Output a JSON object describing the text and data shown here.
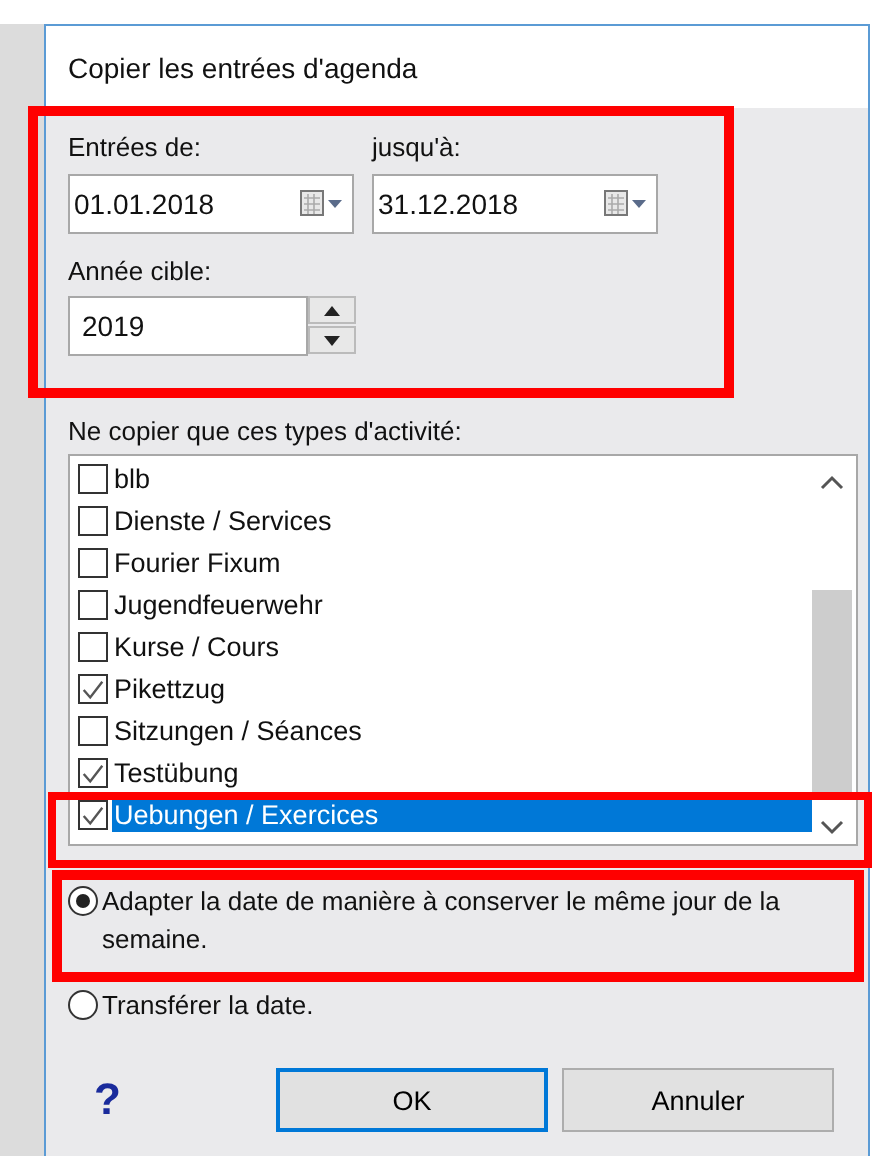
{
  "window": {
    "title": "Copier les entrées d'agenda"
  },
  "date_from": {
    "label": "Entrées de:",
    "value": "01.01.2018"
  },
  "date_to": {
    "label": "jusqu'à:",
    "value": "31.12.2018"
  },
  "target_year": {
    "label": "Année cible:",
    "value": "2019"
  },
  "activity_types": {
    "label": "Ne copier que ces types d'activité:",
    "items": [
      {
        "label": "blb",
        "checked": false,
        "selected": false
      },
      {
        "label": "Dienste / Services",
        "checked": false,
        "selected": false
      },
      {
        "label": "Fourier Fixum",
        "checked": false,
        "selected": false
      },
      {
        "label": "Jugendfeuerwehr",
        "checked": false,
        "selected": false
      },
      {
        "label": "Kurse / Cours",
        "checked": false,
        "selected": false
      },
      {
        "label": "Pikettzug",
        "checked": true,
        "selected": false
      },
      {
        "label": "Sitzungen / Séances",
        "checked": false,
        "selected": false
      },
      {
        "label": "Testübung",
        "checked": true,
        "selected": false
      },
      {
        "label": "Uebungen / Exercices",
        "checked": true,
        "selected": true
      }
    ]
  },
  "date_options": [
    {
      "label": "Adapter la date de manière à conserver le même jour de la semaine.",
      "selected": true
    },
    {
      "label": "Transférer la date.",
      "selected": false
    }
  ],
  "help": "?",
  "buttons": [
    {
      "label": "OK",
      "default": true
    },
    {
      "label": "Annuler",
      "default": false
    }
  ]
}
